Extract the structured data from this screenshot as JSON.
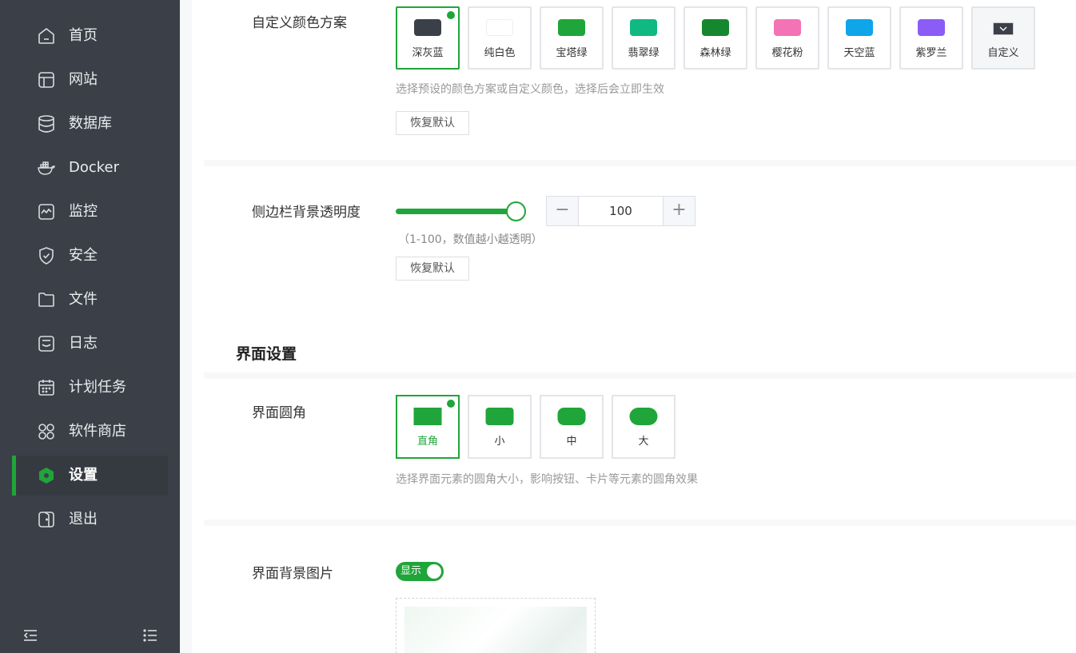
{
  "sidebar": {
    "items": [
      {
        "label": "首页",
        "icon": "home-icon"
      },
      {
        "label": "网站",
        "icon": "website-icon"
      },
      {
        "label": "数据库",
        "icon": "database-icon"
      },
      {
        "label": "Docker",
        "icon": "docker-icon"
      },
      {
        "label": "监控",
        "icon": "monitor-icon"
      },
      {
        "label": "安全",
        "icon": "shield-icon"
      },
      {
        "label": "文件",
        "icon": "folder-icon"
      },
      {
        "label": "日志",
        "icon": "log-icon"
      },
      {
        "label": "计划任务",
        "icon": "calendar-icon"
      },
      {
        "label": "软件商店",
        "icon": "app-store-icon"
      },
      {
        "label": "设置",
        "icon": "settings-icon",
        "active": true
      },
      {
        "label": "退出",
        "icon": "logout-icon"
      }
    ],
    "accent": "#20a53a",
    "background": "#3b4048"
  },
  "color_scheme": {
    "label": "自定义颜色方案",
    "options": [
      {
        "name": "深灰蓝",
        "color": "#3b4048",
        "selected": true
      },
      {
        "name": "纯白色",
        "color": "#ffffff"
      },
      {
        "name": "宝塔绿",
        "color": "#20a53a"
      },
      {
        "name": "翡翠绿",
        "color": "#10b981"
      },
      {
        "name": "森林绿",
        "color": "#15882f"
      },
      {
        "name": "樱花粉",
        "color": "#f472b6"
      },
      {
        "name": "天空蓝",
        "color": "#0ea5e9"
      },
      {
        "name": "紫罗兰",
        "color": "#8b5cf6"
      },
      {
        "name": "自定义",
        "color": "#3b4048"
      }
    ],
    "hint": "选择预设的颜色方案或自定义颜色，选择后会立即生效",
    "reset_label": "恢复默认"
  },
  "sidebar_opacity": {
    "label": "侧边栏背景透明度",
    "value": "100",
    "slider_fraction": 1.0,
    "minus": "−",
    "plus": "+",
    "hint": "（1-100，数值越小越透明）",
    "reset_label": "恢复默认"
  },
  "ui_settings": {
    "title": "界面设置",
    "radius": {
      "label": "界面圆角",
      "options": [
        {
          "name": "直角",
          "selected": true
        },
        {
          "name": "小"
        },
        {
          "name": "中"
        },
        {
          "name": "大"
        }
      ],
      "hint": "选择界面元素的圆角大小，影响按钮、卡片等元素的圆角效果"
    },
    "background_image": {
      "label": "界面背景图片",
      "toggle_label": "显示",
      "enabled": true
    }
  }
}
